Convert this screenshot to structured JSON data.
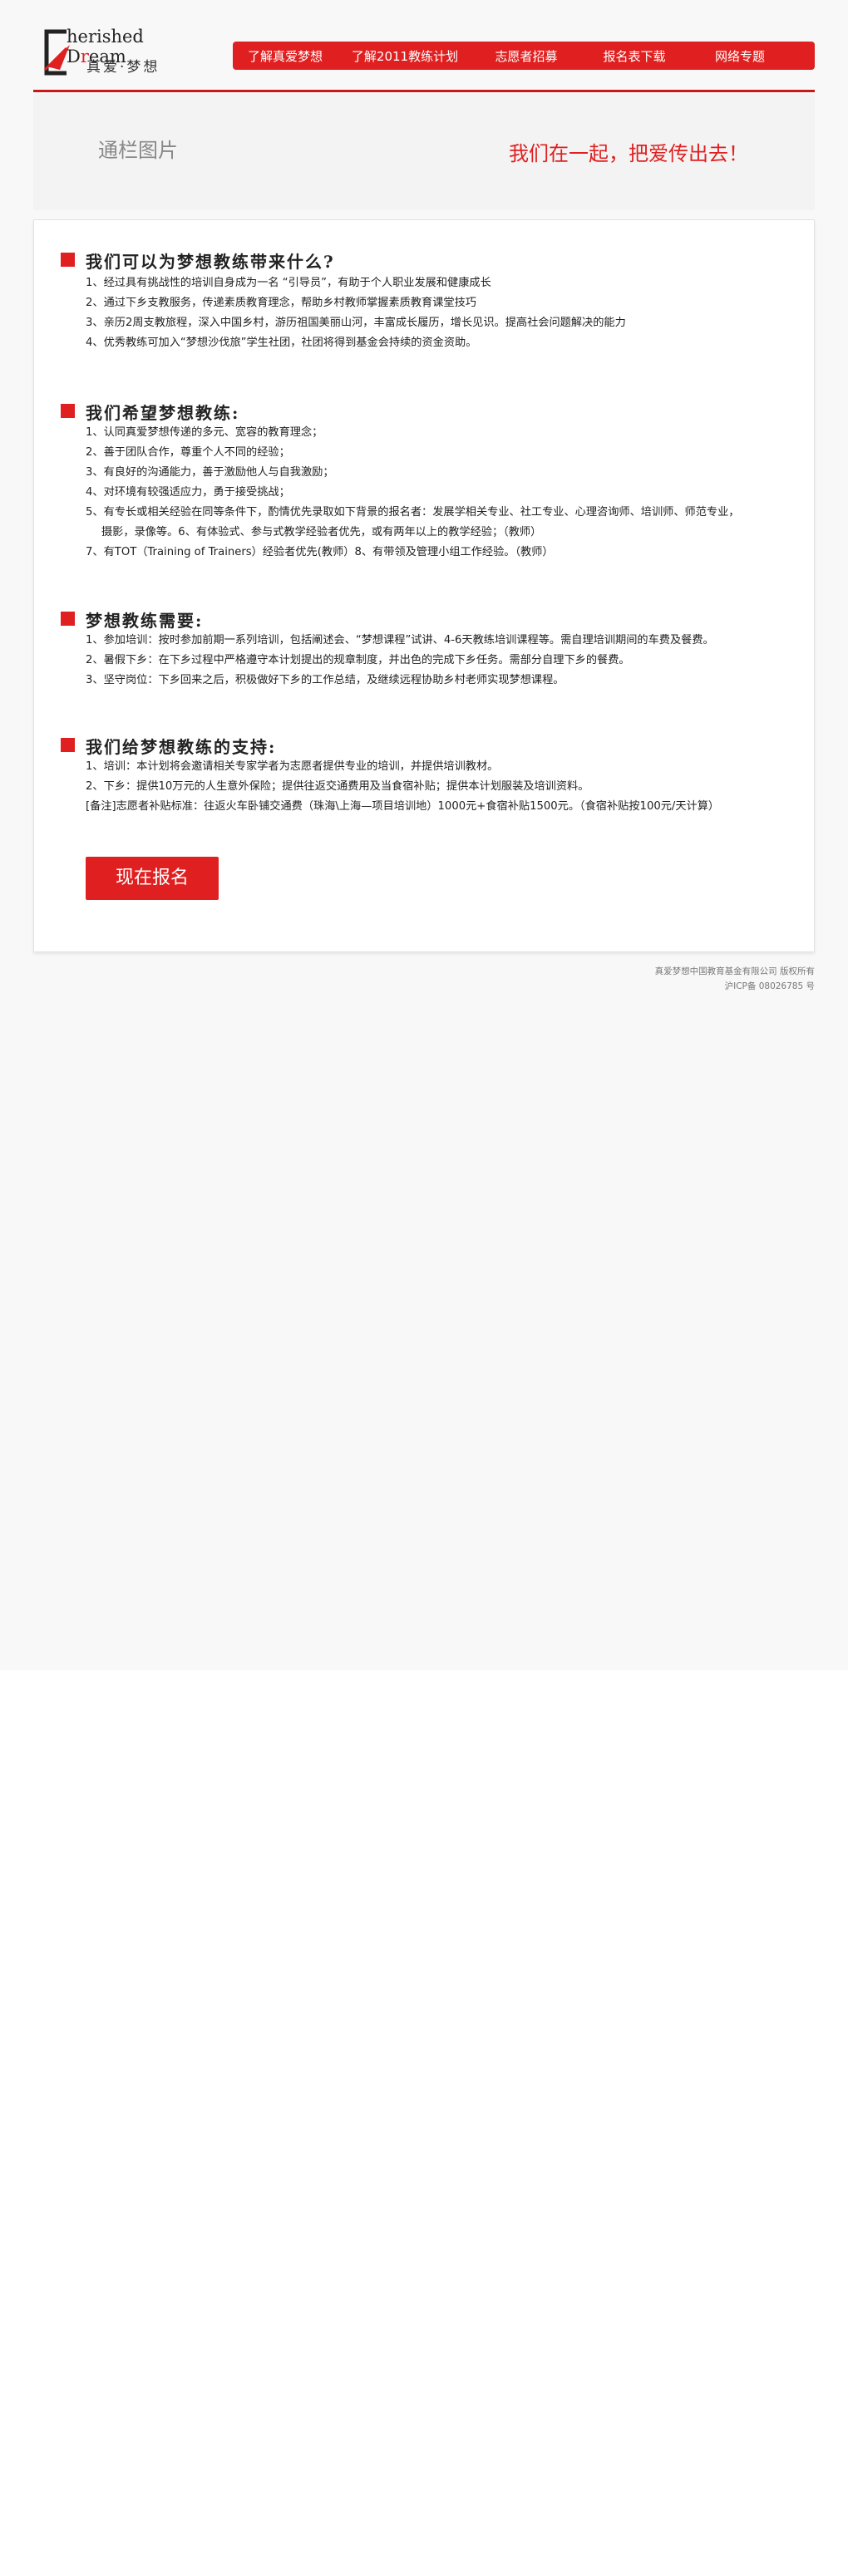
{
  "logo": {
    "en_first": "C",
    "en_rest": "herished D",
    "en_red": "r",
    "en_end": "eam",
    "cn": "真爱·梦想"
  },
  "nav": {
    "items": [
      {
        "label": "了解真爱梦想"
      },
      {
        "label": "了解2011教练计划"
      },
      {
        "label": "志愿者招募"
      },
      {
        "label": "报名表下载"
      },
      {
        "label": "网络专题"
      }
    ]
  },
  "banner": {
    "left_text": "通栏图片",
    "slogan": "我们在一起，把爱传出去！"
  },
  "sections": [
    {
      "title": "我们可以为梦想教练带来什么?",
      "rows": [
        "1、经过具有挑战性的培训自身成为一名 “引导员”，有助于个人职业发展和健康成长",
        "2、通过下乡支教服务，传递素质教育理念，帮助乡村教师掌握素质教育课堂技巧",
        "3、亲历2周支教旅程，深入中国乡村，游历祖国美丽山河，丰富成长履历，增长见识。提高社会问题解决的能力",
        "4、优秀教练可加入“梦想沙伐旅”学生社团，社团将得到基金会持续的资金资助。"
      ]
    },
    {
      "title": "我们希望梦想教练:",
      "rows": [
        "1、认同真爱梦想传递的多元、宽容的教育理念；",
        "2、善于团队合作，尊重个人不同的经验；",
        "3、有良好的沟通能力，善于激励他人与自我激励；",
        "4、对环境有较强适应力，勇于接受挑战；",
        "5、有专长或相关经验在同等条件下，酌情优先录取如下背景的报名者：发展学相关专业、社工专业、心理咨询师、培训师、师范专业，",
        "摄影，录像等。6、有体验式、参与式教学经验者优先，或有两年以上的教学经验；（教师）",
        "7、有TOT（Training of Trainers）经验者优先(教师）8、有带领及管理小组工作经验。（教师）"
      ]
    },
    {
      "title": "梦想教练需要:",
      "rows": [
        "1、参加培训：按时参加前期一系列培训，包括阐述会、“梦想课程”试讲、4-6天教练培训课程等。需自理培训期间的车费及餐费。",
        "2、暑假下乡：在下乡过程中严格遵守本计划提出的规章制度，并出色的完成下乡任务。需部分自理下乡的餐费。",
        "3、坚守岗位：下乡回来之后，积极做好下乡的工作总结，及继续远程协助乡村老师实现梦想课程。"
      ]
    },
    {
      "title": "我们给梦想教练的支持:",
      "rows": [
        "1、培训：本计划将会邀请相关专家学者为志愿者提供专业的培训，并提供培训教材。",
        "2、下乡：提供10万元的人生意外保险；提供往返交通费用及当食宿补贴；提供本计划服装及培训资料。",
        "[备注]志愿者补贴标准：往返火车卧铺交通费（珠海\\上海—项目培训地）1000元+食宿补贴1500元。（食宿补贴按100元/天计算）"
      ]
    }
  ],
  "signup": {
    "label": "现在报名"
  },
  "footer": {
    "copyright": "真爱梦想中国教育基金有限公司 版权所有",
    "icp": "沪ICP备 08026785 号"
  },
  "colors": {
    "accent": "#e02020",
    "banner_bg": "#f3f3f3",
    "page_bg": "#f8f8f8"
  }
}
